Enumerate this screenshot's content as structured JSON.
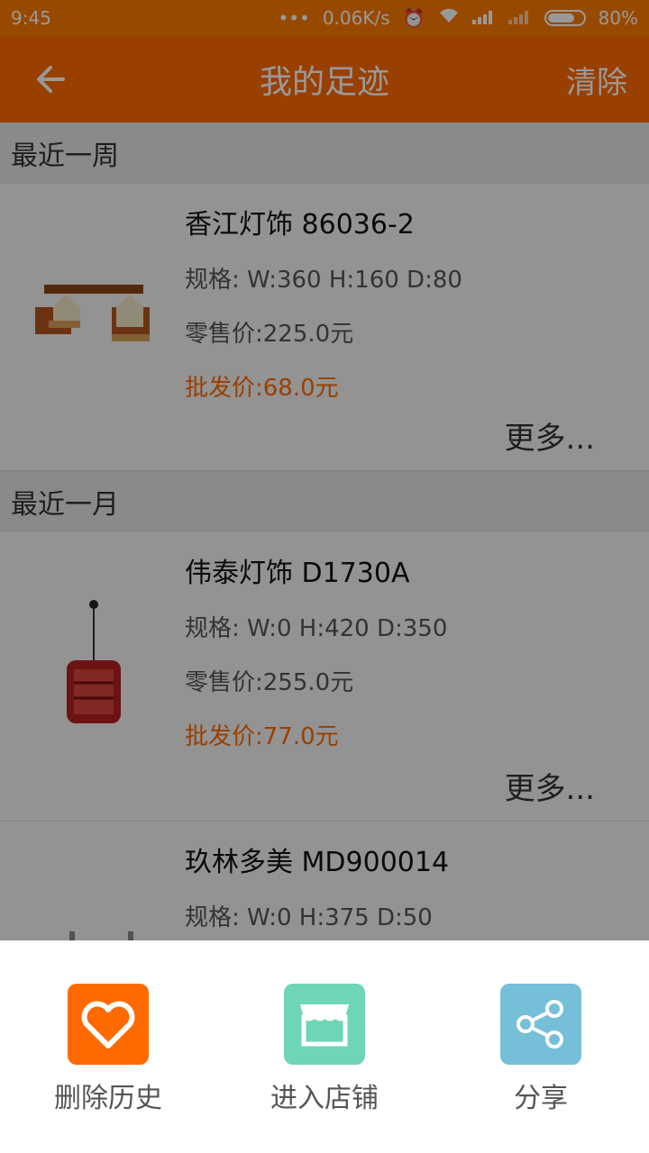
{
  "status_bar": {
    "time": "9:45",
    "dots": "•••",
    "network_speed": "0.06K/s",
    "battery": "80%"
  },
  "header": {
    "title": "我的足迹",
    "clear_label": "清除"
  },
  "sections": [
    {
      "title": "最近一周",
      "items": [
        {
          "name": "香江灯饰 86036-2",
          "spec": "规格: W:360 H:160 D:80",
          "retail_price": "零售价:225.0元",
          "wholesale_price": "批发价:68.0元",
          "more_label": "更多..."
        }
      ]
    },
    {
      "title": "最近一月",
      "items": [
        {
          "name": "伟泰灯饰 D1730A",
          "spec": "规格: W:0 H:420 D:350",
          "retail_price": "零售价:255.0元",
          "wholesale_price": "批发价:77.0元",
          "more_label": "更多..."
        },
        {
          "name": "玖林多美 MD900014",
          "spec": "规格: W:0 H:375 D:50"
        }
      ]
    }
  ],
  "bottom_sheet": {
    "actions": [
      {
        "label": "删除历史",
        "icon": "heart-icon",
        "color": "#ff6a00"
      },
      {
        "label": "进入店铺",
        "icon": "store-icon",
        "color": "#6ed6b6"
      },
      {
        "label": "分享",
        "icon": "share-icon",
        "color": "#75bfd8"
      }
    ]
  }
}
